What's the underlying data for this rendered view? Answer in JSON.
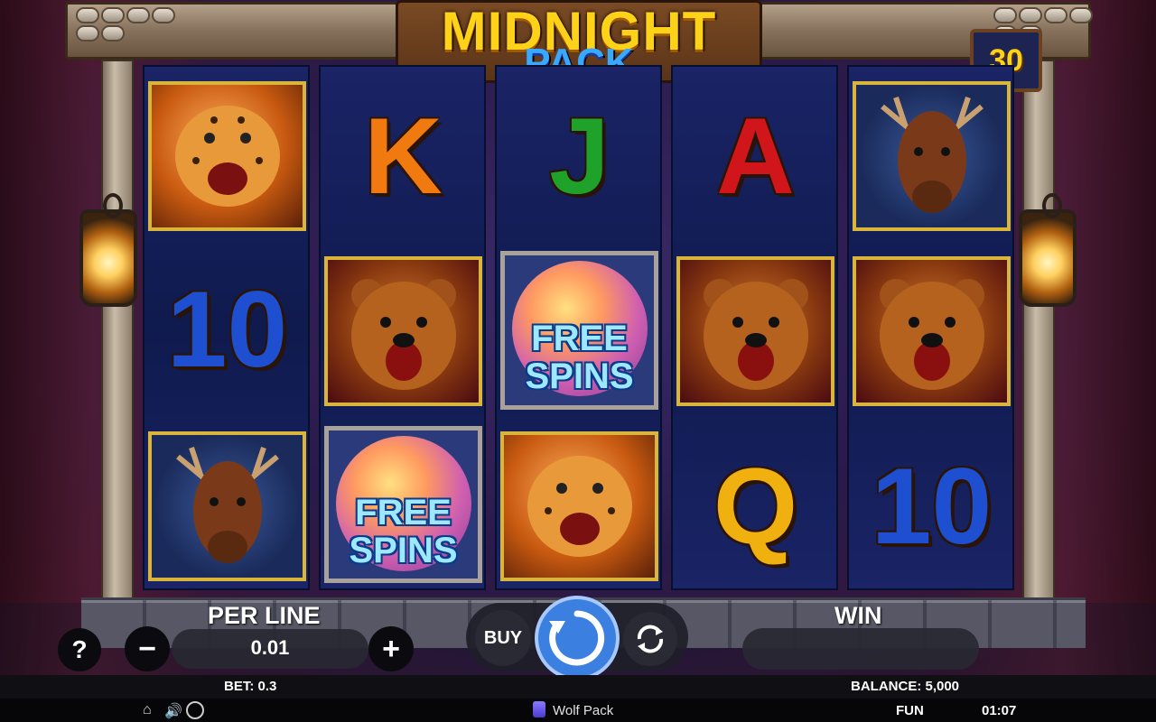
{
  "game": {
    "logo_line1": "MIDNIGHT",
    "logo_line2": "PACK",
    "lines_count": "30"
  },
  "reels": [
    [
      {
        "type": "leopard-icon"
      },
      {
        "text": "10",
        "color": "#1d4fd0"
      },
      {
        "type": "moose-icon"
      }
    ],
    [
      {
        "text": "K",
        "color": "#f07a10"
      },
      {
        "type": "bear-icon"
      },
      {
        "type": "free-spins",
        "text": "FREE SPINS"
      }
    ],
    [
      {
        "text": "J",
        "color": "#1fa22a"
      },
      {
        "type": "free-spins",
        "text": "FREE SPINS"
      },
      {
        "type": "leopard-icon"
      }
    ],
    [
      {
        "text": "A",
        "color": "#d0161a"
      },
      {
        "type": "bear-icon"
      },
      {
        "text": "Q",
        "color": "#f0b010"
      }
    ],
    [
      {
        "type": "moose-icon"
      },
      {
        "type": "bear-icon"
      },
      {
        "text": "10",
        "color": "#1d4fd0"
      }
    ]
  ],
  "controls": {
    "help": "?",
    "per_line_label": "PER LINE",
    "per_line_value": "0.01",
    "minus": "−",
    "plus": "+",
    "buy": "BUY",
    "win_label": "WIN"
  },
  "status": {
    "bet": "BET: 0.3",
    "balance": "BALANCE: 5,000"
  },
  "footer": {
    "title": "Wolf Pack",
    "mode": "FUN",
    "clock": "01:07"
  },
  "colors": {
    "gold": "#ffd21a",
    "logo_blue": "#3aa8ff",
    "reel_bg": "#0f1a4e",
    "frame_gold": "#d9b53c"
  }
}
